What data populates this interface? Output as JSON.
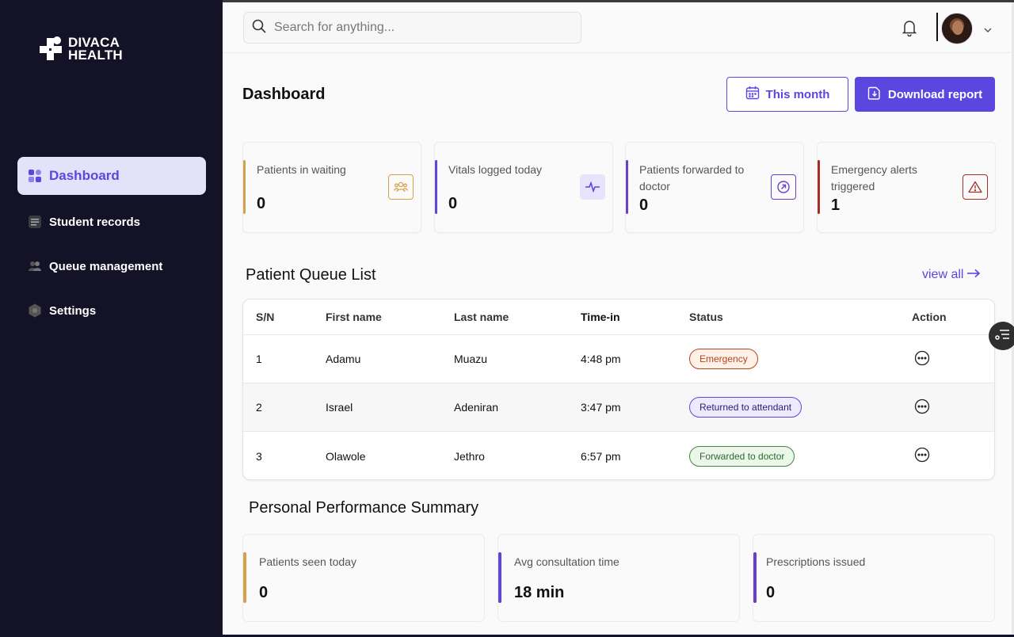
{
  "brand": {
    "line1": "DIVACA",
    "line2": "HEALTH"
  },
  "sidebar": {
    "items": [
      {
        "label": "Dashboard",
        "icon": "dashboard-grid-icon",
        "active": true
      },
      {
        "label": "Student records",
        "icon": "document-icon"
      },
      {
        "label": "Queue management",
        "icon": "people-icon"
      },
      {
        "label": "Settings",
        "icon": "gear-icon"
      }
    ]
  },
  "header": {
    "search_placeholder": "Search for anything..."
  },
  "page": {
    "title": "Dashboard",
    "month_button": "This month",
    "download_button": "Download report"
  },
  "stats": [
    {
      "label": "Patients in waiting",
      "value": "0",
      "color": "#d4a24a",
      "icon": "users-icon"
    },
    {
      "label": "Vitals logged today",
      "value": "0",
      "color": "#5b46e0",
      "icon": "pulse-icon"
    },
    {
      "label": "Patients forwarded to doctor",
      "value": "0",
      "color": "#6a3fc9",
      "icon": "forward-arrow-icon"
    },
    {
      "label": "Emergency alerts triggered",
      "value": "1",
      "color": "#a3302a",
      "icon": "warning-icon"
    }
  ],
  "queue": {
    "title": "Patient Queue List",
    "view_all": "view all",
    "columns": [
      "S/N",
      "First name",
      "Last name",
      "Time-in",
      "Status",
      "Action"
    ],
    "rows": [
      {
        "sn": "1",
        "first": "Adamu",
        "last": "Muazu",
        "time": "4:48 pm",
        "status": "Emergency",
        "status_type": "emergency"
      },
      {
        "sn": "2",
        "first": "Israel",
        "last": "Adeniran",
        "time": "3:47 pm",
        "status": "Returned to attendant",
        "status_type": "returned"
      },
      {
        "sn": "3",
        "first": "Olawole",
        "last": "Jethro",
        "time": "6:57 pm",
        "status": "Forwarded to doctor",
        "status_type": "forwarded"
      }
    ]
  },
  "performance": {
    "title": "Personal Performance Summary",
    "cards": [
      {
        "label": "Patients seen today",
        "value": "0",
        "color": "#d4a24a"
      },
      {
        "label": "Avg consultation time",
        "value": "18 min",
        "color": "#5b46e0"
      },
      {
        "label": "Prescriptions issued",
        "value": "0",
        "color": "#6a3fc9"
      }
    ]
  }
}
